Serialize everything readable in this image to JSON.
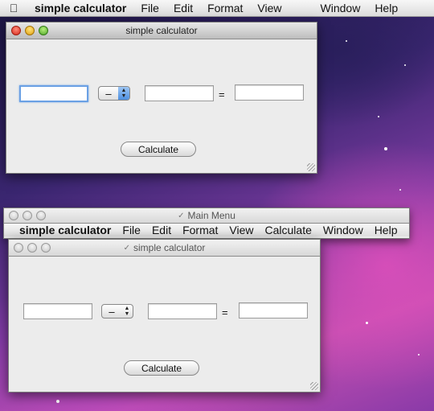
{
  "system_menubar": {
    "app_name": "simple calculator",
    "items": [
      "File",
      "Edit",
      "Format",
      "View",
      "Window",
      "Help"
    ]
  },
  "window_front": {
    "title": "simple calculator",
    "operator": "–",
    "operand1": "",
    "operand2": "",
    "result": "",
    "equals": "=",
    "button": "Calculate"
  },
  "main_menu_window": {
    "title": "Main Menu",
    "app_name": "simple calculator",
    "items": [
      "File",
      "Edit",
      "Format",
      "View",
      "Calculate",
      "Window",
      "Help"
    ]
  },
  "window_back": {
    "title": "simple calculator",
    "operator": "–",
    "operand1": "",
    "operand2": "",
    "result": "",
    "equals": "=",
    "button": "Calculate"
  }
}
